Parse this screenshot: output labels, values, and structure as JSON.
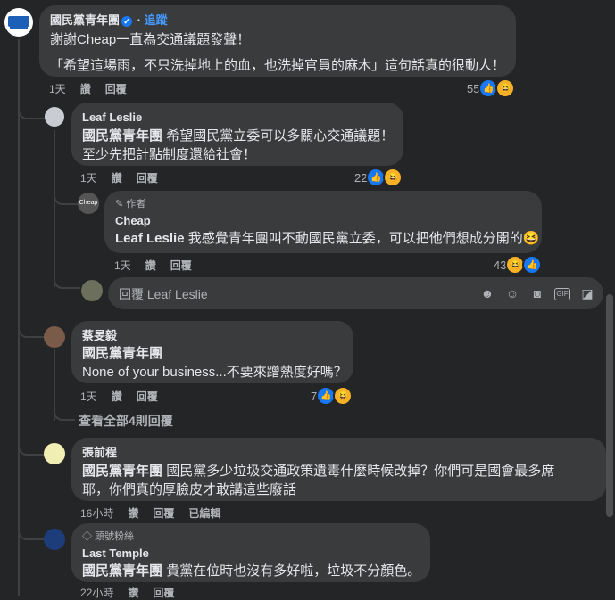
{
  "c1": {
    "author": "國民黨青年團",
    "follow": "追蹤",
    "line1": "謝謝Cheap一直為交通議題發聲！",
    "line2": "「希望這場雨，不只洗掉地上的血，也洗掉官員的麻木」這句話真的很動人！",
    "time": "1天",
    "like": "讚",
    "reply": "回覆",
    "count": "55"
  },
  "c2": {
    "author": "Leaf Leslie",
    "mention": "國民黨青年團",
    "line1": "希望國民黨立委可以多關心交通議題！",
    "line2": "至少先把計點制度還給社會！",
    "time": "1天",
    "like": "讚",
    "reply": "回覆",
    "count": "22"
  },
  "c3": {
    "badge": "作者",
    "author": "Cheap",
    "mention": "Leaf Leslie",
    "line1": "我感覺青年團叫不動國民黨立委，可以把他們想成分開的😆",
    "time": "1天",
    "like": "讚",
    "reply": "回覆",
    "count": "43"
  },
  "replyBox": {
    "placeholder": "回覆 Leaf Leslie"
  },
  "c4": {
    "author": "蔡旻毅",
    "mention": "國民黨青年團",
    "line1": "None of your business...不要來蹭熱度好嗎？",
    "time": "1天",
    "like": "讚",
    "reply": "回覆",
    "count": "7"
  },
  "viewAll": "查看全部4則回覆",
  "c5": {
    "author": "張前程",
    "mention": "國民黨青年團",
    "line1": "國民黨多少垃圾交通政策遺毒什麼時候改掉？你們可是國會最多席",
    "line2": "耶，你們真的厚臉皮才敢講這些廢話",
    "time": "16小時",
    "like": "讚",
    "reply": "回覆",
    "edited": "已編輯"
  },
  "c6": {
    "badge": "頭號粉絲",
    "author": "Last Temple",
    "mention": "國民黨青年團",
    "line1": "貴黨在位時也沒有多好啦，垃圾不分顏色。",
    "time": "22小時",
    "like": "讚",
    "reply": "回覆"
  },
  "icons": [
    "like-icon",
    "haha-icon",
    "emoji-icon",
    "camera-icon",
    "gif-icon",
    "sticker-icon",
    "avatar-icon",
    "pencil-icon",
    "diamond-icon",
    "verified-icon"
  ]
}
